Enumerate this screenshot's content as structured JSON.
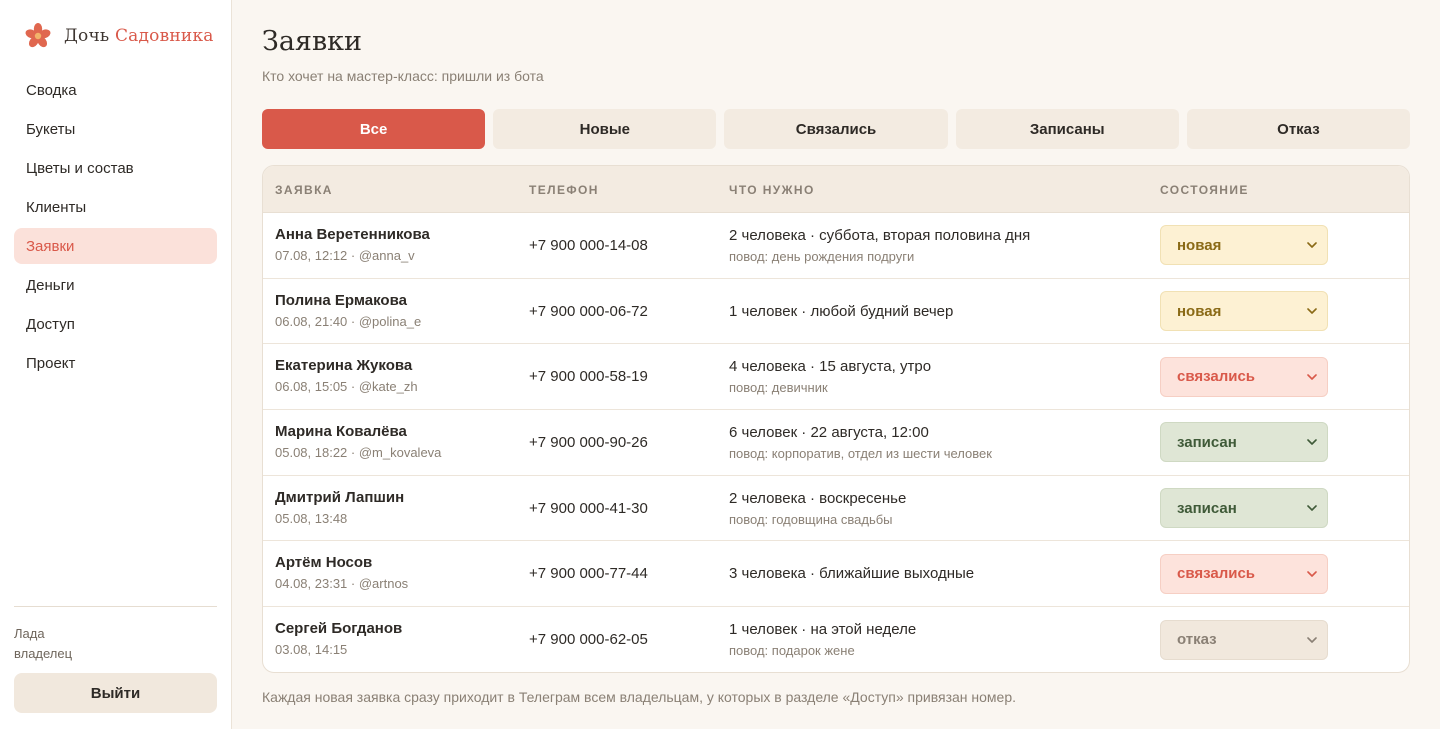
{
  "brand": {
    "name_part1": "Дочь",
    "name_part2": "Садовника"
  },
  "nav": {
    "items": [
      {
        "label": "Сводка"
      },
      {
        "label": "Букеты"
      },
      {
        "label": "Цветы и состав"
      },
      {
        "label": "Клиенты"
      },
      {
        "label": "Заявки",
        "active": true
      },
      {
        "label": "Деньги"
      },
      {
        "label": "Доступ"
      },
      {
        "label": "Проект"
      }
    ]
  },
  "user": {
    "name": "Лада",
    "role": "владелец",
    "logout_label": "Выйти"
  },
  "page": {
    "title": "Заявки",
    "subtitle": "Кто хочет на мастер-класс: пришли из бота"
  },
  "tabs": [
    {
      "label": "Все",
      "active": true
    },
    {
      "label": "Новые"
    },
    {
      "label": "Связались"
    },
    {
      "label": "Записаны"
    },
    {
      "label": "Отказ"
    }
  ],
  "table": {
    "headers": {
      "request": "Заявка",
      "phone": "Телефон",
      "need": "Что нужно",
      "state": "Состояние"
    },
    "rows": [
      {
        "name": "Анна Веретенникова",
        "meta": "07.08, 12:12 · @anna_v",
        "phone": "+7 900 000-14-08",
        "need": "2 человека · суббота, вторая половина дня",
        "reason": "повод: день рождения подруги",
        "status": "новая",
        "status_kind": "new"
      },
      {
        "name": "Полина Ермакова",
        "meta": "06.08, 21:40 · @polina_e",
        "phone": "+7 900 000-06-72",
        "need": "1 человек · любой будний вечер",
        "reason": "",
        "status": "новая",
        "status_kind": "new"
      },
      {
        "name": "Екатерина Жукова",
        "meta": "06.08, 15:05 · @kate_zh",
        "phone": "+7 900 000-58-19",
        "need": "4 человека · 15 августа, утро",
        "reason": "повод: девичник",
        "status": "связались",
        "status_kind": "contacted"
      },
      {
        "name": "Марина Ковалёва",
        "meta": "05.08, 18:22 · @m_kovaleva",
        "phone": "+7 900 000-90-26",
        "need": "6 человек · 22 августа, 12:00",
        "reason": "повод: корпоратив, отдел из шести человек",
        "status": "записан",
        "status_kind": "signed"
      },
      {
        "name": "Дмитрий Лапшин",
        "meta": "05.08, 13:48",
        "phone": "+7 900 000-41-30",
        "need": "2 человека · воскресенье",
        "reason": "повод: годовщина свадьбы",
        "status": "записан",
        "status_kind": "signed"
      },
      {
        "name": "Артём Носов",
        "meta": "04.08, 23:31 · @artnos",
        "phone": "+7 900 000-77-44",
        "need": "3 человека · ближайшие выходные",
        "reason": "",
        "status": "связались",
        "status_kind": "contacted"
      },
      {
        "name": "Сергей Богданов",
        "meta": "03.08, 14:15",
        "phone": "+7 900 000-62-05",
        "need": "1 человек · на этой неделе",
        "reason": "повод: подарок жене",
        "status": "отказ",
        "status_kind": "refused"
      }
    ]
  },
  "footer_note": "Каждая новая заявка сразу приходит в Телеграм всем владельцам, у которых в разделе «Доступ» привязан номер.",
  "colors": {
    "accent": "#d9594a",
    "background": "#faf6f1",
    "status_new": "#fdf1d3",
    "status_contacted": "#fde3dc",
    "status_signed": "#dfe6d5",
    "status_refused": "#f1e8dd"
  },
  "icons": {
    "brand": "flower-icon",
    "select": "chevron-down-icon"
  }
}
